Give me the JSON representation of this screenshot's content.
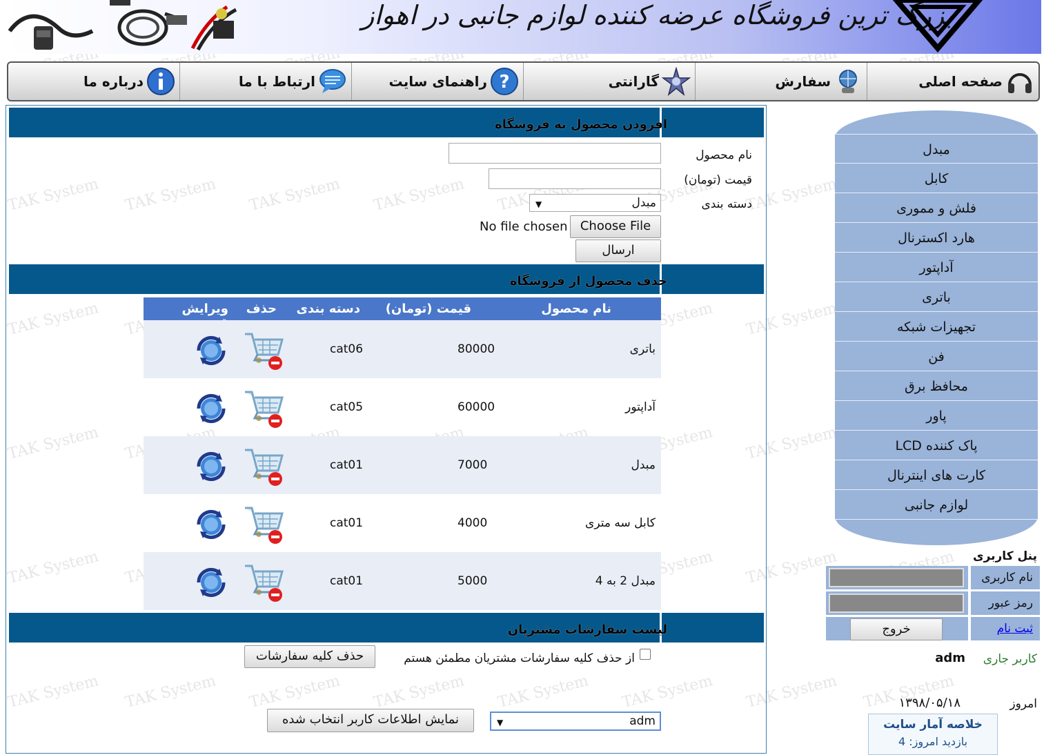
{
  "banner": {
    "slogan": "بزرگ ترین فروشگاه عرضه کننده لوازم جانبی در اهواز"
  },
  "nav": {
    "items": [
      {
        "label": "صفحه اصلی",
        "icon": "headphones-icon"
      },
      {
        "label": "سفارش",
        "icon": "support-globe-icon"
      },
      {
        "label": "گارانتی",
        "icon": "star-badge-icon"
      },
      {
        "label": "راهنمای سایت",
        "icon": "help-question-icon"
      },
      {
        "label": "ارتباط با ما",
        "icon": "chat-bubble-icon"
      },
      {
        "label": "درباره ما",
        "icon": "info-icon"
      }
    ]
  },
  "add_product": {
    "title": "افزودن محصول به فروشگاه",
    "name_label": "نام محصول",
    "name_value": "",
    "price_label": "قیمت (تومان)",
    "price_value": "",
    "category_label": "دسته بندی",
    "category_selected": "مبدل",
    "file_button": "Choose File",
    "file_status": "No file chosen",
    "submit_label": "ارسال"
  },
  "delete_product": {
    "title": "حذف محصول از فروشگاه",
    "columns": {
      "name": "نام محصول",
      "price": "قیمت (تومان)",
      "category": "دسته بندی",
      "delete": "حذف",
      "edit": "ویرایش قیمت"
    },
    "rows": [
      {
        "name": "باتری",
        "price": "80000",
        "category": "cat06"
      },
      {
        "name": "آداپتور",
        "price": "60000",
        "category": "cat05"
      },
      {
        "name": "مبدل",
        "price": "7000",
        "category": "cat01"
      },
      {
        "name": "کابل سه متری",
        "price": "4000",
        "category": "cat01"
      },
      {
        "name": "مبدل 2 به 4",
        "price": "5000",
        "category": "cat01"
      }
    ]
  },
  "orders": {
    "title": "لیست سفارشات مشتریان",
    "confirm_label": "از حذف کلیه سفارشات مشتریان مطمئن هستم",
    "delete_all_label": "حذف کلیه سفارشات",
    "user_select_value": "adm",
    "show_user_label": "نمایش اطلاعات کاربر انتخاب شده"
  },
  "categories": [
    "مبدل",
    "کابل",
    "فلش و مموری",
    "هارد اکسترنال",
    "آداپتور",
    "باتری",
    "تجهیزات شبکه",
    "فن",
    "محافظ برق",
    "پاور",
    "پاک کننده LCD",
    "کارت های اینترنال",
    "لوازم جانبی"
  ],
  "user_panel": {
    "title": "پنل کاربری",
    "username_label": "نام کاربری",
    "password_label": "رمز عبور",
    "register_link": "ثبت نام",
    "logout_label": "خروج",
    "current_user_label": "کاربر جاری",
    "current_user": "adm",
    "today_label": "امروز",
    "today_date": "۱۳۹۸/۰۵/۱۸",
    "stats_title": "خلاصه آمار سایت",
    "visits_today": "بازدید امروز: 4"
  },
  "watermark": "TAK System",
  "colors": {
    "section_header": "#05588c",
    "table_header": "#4a77c9",
    "menu_bg": "#99b3d9",
    "link": "#0000ee",
    "green_label": "#2e7d32"
  }
}
